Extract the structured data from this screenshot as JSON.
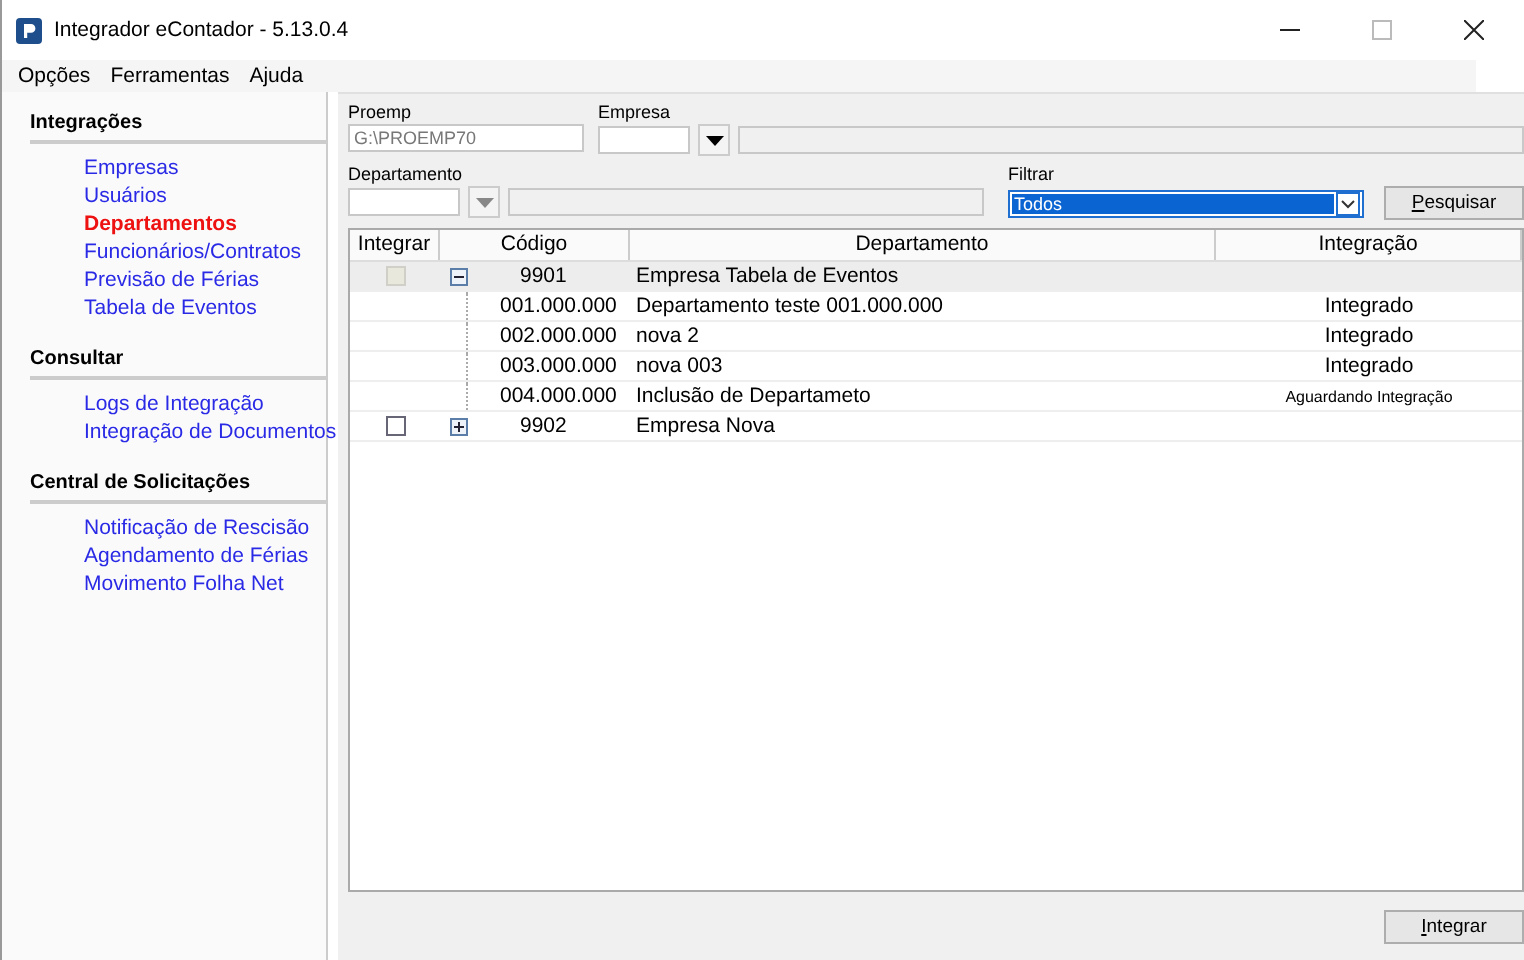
{
  "window": {
    "title": "Integrador eContador - 5.13.0.4"
  },
  "menu": [
    "Opções",
    "Ferramentas",
    "Ajuda"
  ],
  "sidebar": [
    {
      "heading": "Integrações",
      "items": [
        {
          "label": "Empresas",
          "selected": false
        },
        {
          "label": "Usuários",
          "selected": false
        },
        {
          "label": "Departamentos",
          "selected": true
        },
        {
          "label": "Funcionários/Contratos",
          "selected": false
        },
        {
          "label": "Previsão de Férias",
          "selected": false
        },
        {
          "label": "Tabela de Eventos",
          "selected": false
        }
      ]
    },
    {
      "heading": "Consultar",
      "items": [
        {
          "label": "Logs de Integração",
          "selected": false
        },
        {
          "label": "Integração de Documentos",
          "selected": false
        }
      ]
    },
    {
      "heading": "Central de Solicitações",
      "items": [
        {
          "label": "Notificação de Rescisão",
          "selected": false
        },
        {
          "label": "Agendamento de Férias",
          "selected": false
        },
        {
          "label": "Movimento Folha Net",
          "selected": false
        }
      ]
    }
  ],
  "filters": {
    "proemp": {
      "label": "Proemp",
      "value": "G:\\PROEMP70"
    },
    "empresa": {
      "label": "Empresa"
    },
    "departamento": {
      "label": "Departamento"
    },
    "filtrar": {
      "label": "Filtrar",
      "value": "Todos"
    },
    "search_button": "Pesquisar"
  },
  "table": {
    "columns": [
      "Integrar",
      "Código",
      "Departamento",
      "Integração"
    ],
    "rows": [
      {
        "code": "9901",
        "name": "Empresa Tabela de Eventos",
        "checked": false,
        "disabled": true,
        "expanded": true,
        "selected": true,
        "children": [
          {
            "code": "001.000.000",
            "name": "Departamento teste 001.000.000",
            "status": "Integrado"
          },
          {
            "code": "002.000.000",
            "name": "nova 2",
            "status": "Integrado"
          },
          {
            "code": "003.000.000",
            "name": "nova 003",
            "status": "Integrado"
          },
          {
            "code": "004.000.000",
            "name": "Inclusão de Departameto",
            "status": "Aguardando Integração"
          }
        ]
      },
      {
        "code": "9902",
        "name": "Empresa Nova",
        "checked": false,
        "disabled": false,
        "expanded": false,
        "selected": false
      }
    ]
  },
  "footer_button": "Integrar"
}
